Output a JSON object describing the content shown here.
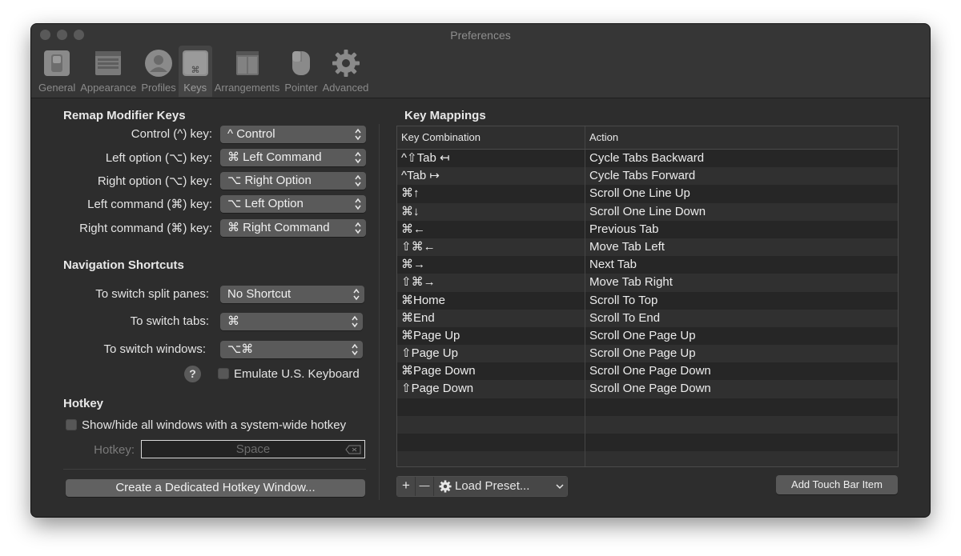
{
  "window": {
    "title": "Preferences"
  },
  "toolbar": {
    "items": [
      {
        "label": "General",
        "icon": "switch-icon",
        "active": false
      },
      {
        "label": "Appearance",
        "icon": "window-icon",
        "active": false
      },
      {
        "label": "Profiles",
        "icon": "person-icon",
        "active": false
      },
      {
        "label": "Keys",
        "icon": "command-key-icon",
        "active": true
      },
      {
        "label": "Arrangements",
        "icon": "stacked-windows-icon",
        "active": false
      },
      {
        "label": "Pointer",
        "icon": "mouse-icon",
        "active": false
      },
      {
        "label": "Advanced",
        "icon": "gear-icon",
        "active": false
      }
    ]
  },
  "remap": {
    "title": "Remap Modifier Keys",
    "rows": [
      {
        "label": "Control (^) key:",
        "value": "^ Control"
      },
      {
        "label": "Left option (⌥) key:",
        "value": "⌘ Left Command"
      },
      {
        "label": "Right option (⌥) key:",
        "value": "⌥ Right Option"
      },
      {
        "label": "Left command (⌘) key:",
        "value": "⌥ Left Option"
      },
      {
        "label": "Right command (⌘) key:",
        "value": "⌘ Right Command"
      }
    ]
  },
  "navigation": {
    "title": "Navigation Shortcuts",
    "rows": [
      {
        "label": "To switch split panes:",
        "value": "No Shortcut"
      },
      {
        "label": "To switch tabs:",
        "value": "⌘"
      },
      {
        "label": "To switch windows:",
        "value": "⌥⌘"
      }
    ],
    "help": "?",
    "emulate_label": "Emulate U.S. Keyboard"
  },
  "hotkey": {
    "title": "Hotkey",
    "show_hide_label": "Show/hide all windows with a system-wide hotkey",
    "field_label": "Hotkey:",
    "field_value": "Space",
    "create_button": "Create a Dedicated Hotkey Window..."
  },
  "key_mappings": {
    "title": "Key Mappings",
    "columns": [
      "Key Combination",
      "Action"
    ],
    "rows": [
      {
        "combo": "^⇧Tab ↤",
        "action": "Cycle Tabs Backward"
      },
      {
        "combo": "^Tab ↦",
        "action": "Cycle Tabs Forward"
      },
      {
        "combo": "⌘↑",
        "action": "Scroll One Line Up"
      },
      {
        "combo": "⌘↓",
        "action": "Scroll One Line Down"
      },
      {
        "combo": "⌘←",
        "action": "Previous Tab"
      },
      {
        "combo": "⇧⌘←",
        "action": "Move Tab Left"
      },
      {
        "combo": "⌘→",
        "action": "Next Tab"
      },
      {
        "combo": "⇧⌘→",
        "action": "Move Tab Right"
      },
      {
        "combo": "⌘Home",
        "action": "Scroll To Top"
      },
      {
        "combo": "⌘End",
        "action": "Scroll To End"
      },
      {
        "combo": "⌘Page Up",
        "action": "Scroll One Page Up"
      },
      {
        "combo": "⇧Page Up",
        "action": "Scroll One Page Up"
      },
      {
        "combo": "⌘Page Down",
        "action": "Scroll One Page Down"
      },
      {
        "combo": "⇧Page Down",
        "action": "Scroll One Page Down"
      }
    ],
    "add": "+",
    "remove": "—",
    "load_preset": "Load Preset...",
    "add_touch_bar": "Add Touch Bar Item"
  }
}
